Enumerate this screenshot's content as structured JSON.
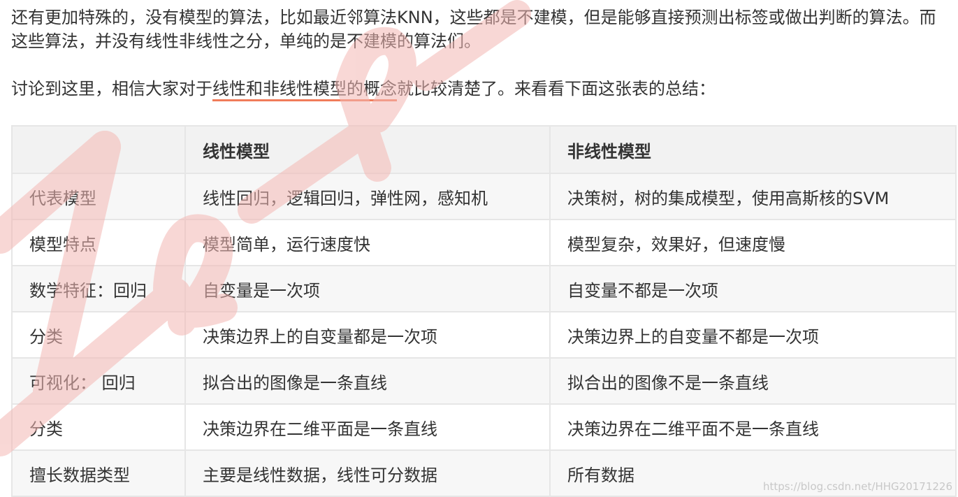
{
  "paragraphs": {
    "p1": "还有更加特殊的，没有模型的算法，比如最近邻算法KNN，这些都是不建模，但是能够直接预测出标签或做出判断的算法。而这些算法，并没有线性非线性之分，单纯的是不建模的算法们。",
    "p2_before": "讨论到这里，相信大家对于",
    "p2_highlight": "线性和非线性模型的概念",
    "p2_after": "就比较清楚了。来看看下面这张表的总结："
  },
  "table": {
    "headers": [
      "",
      "线性模型",
      "非线性模型"
    ],
    "rows": [
      [
        "代表模型",
        "线性回归，逻辑回归，弹性网，感知机",
        "决策树，树的集成模型，使用高斯核的SVM"
      ],
      [
        "模型特点",
        "模型简单，运行速度快",
        "模型复杂，效果好，但速度慢"
      ],
      [
        "数学特征：回归",
        "自变量是一次项",
        "自变量不都是一次项"
      ],
      [
        "分类",
        "决策边界上的自变量都是一次项",
        "决策边界上的自变量不都是一次项"
      ],
      [
        "可视化： 回归",
        "拟合出的图像是一条直线",
        "拟合出的图像不是一条直线"
      ],
      [
        "分类",
        "决策边界在二维平面是一条直线",
        "决策边界在二维平面不是一条直线"
      ],
      [
        "擅长数据类型",
        "主要是线性数据，线性可分数据",
        "所有数据"
      ]
    ]
  },
  "watermark": {
    "url_text": "https://blog.csdn.net/HHG20171226",
    "overlay_color": "#f4b8b4"
  }
}
